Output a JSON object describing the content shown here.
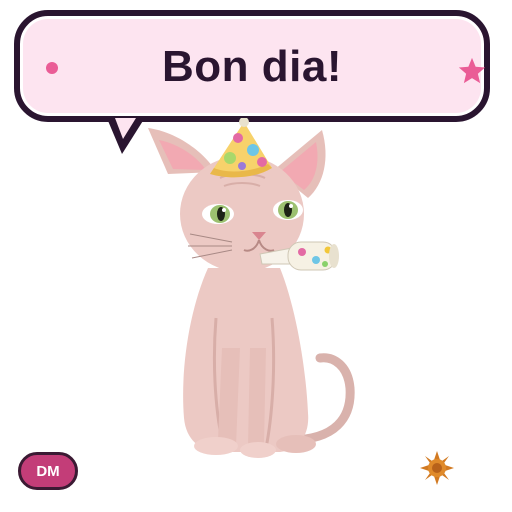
{
  "greeting": {
    "text": "Bon dia!"
  },
  "badge": {
    "text": "DM"
  },
  "colors": {
    "bubble_fill": "#fde4f0",
    "bubble_border": "#2a1530",
    "accent_pink": "#ea5c96",
    "badge_fill": "#c33d78"
  },
  "icons": {
    "bubble_left": "dot-icon",
    "bubble_right": "star-icon",
    "corner": "sun-icon"
  }
}
